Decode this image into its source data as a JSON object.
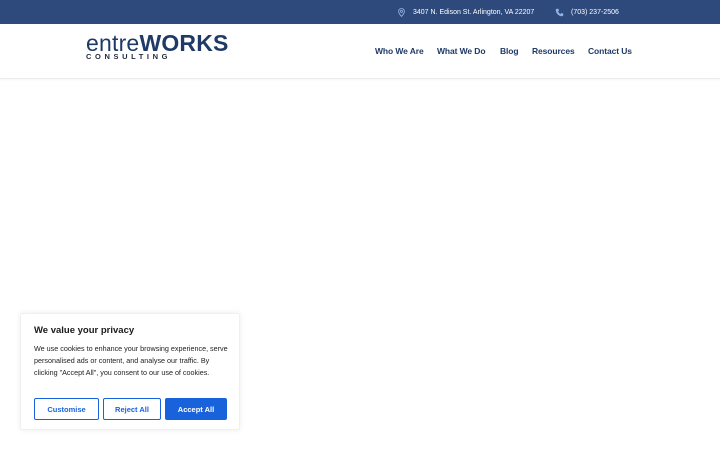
{
  "topbar": {
    "address": "3407 N. Edison St. Arlington, VA 22207",
    "address_icon": "map-pin-icon",
    "phone": "(703) 237-2506",
    "phone_icon": "phone-icon"
  },
  "logo": {
    "word_light": "entre",
    "word_bold": "WORKS",
    "sub": "CONSULTING"
  },
  "nav": {
    "items": [
      "Who We Are",
      "What We Do",
      "Blog",
      "Resources",
      "Contact Us"
    ]
  },
  "cookie": {
    "title": "We value your privacy",
    "text": "We use cookies to enhance your browsing experience, serve personalised ads or content, and analyse our traffic. By clicking \"Accept All\", you consent to our use of cookies.",
    "customise_label": "Customise",
    "reject_label": "Reject All",
    "accept_label": "Accept All"
  },
  "colors": {
    "topbar_bg": "#2e4a7d",
    "brand_navy": "#1f3a66",
    "accent_blue": "#1863dc"
  }
}
